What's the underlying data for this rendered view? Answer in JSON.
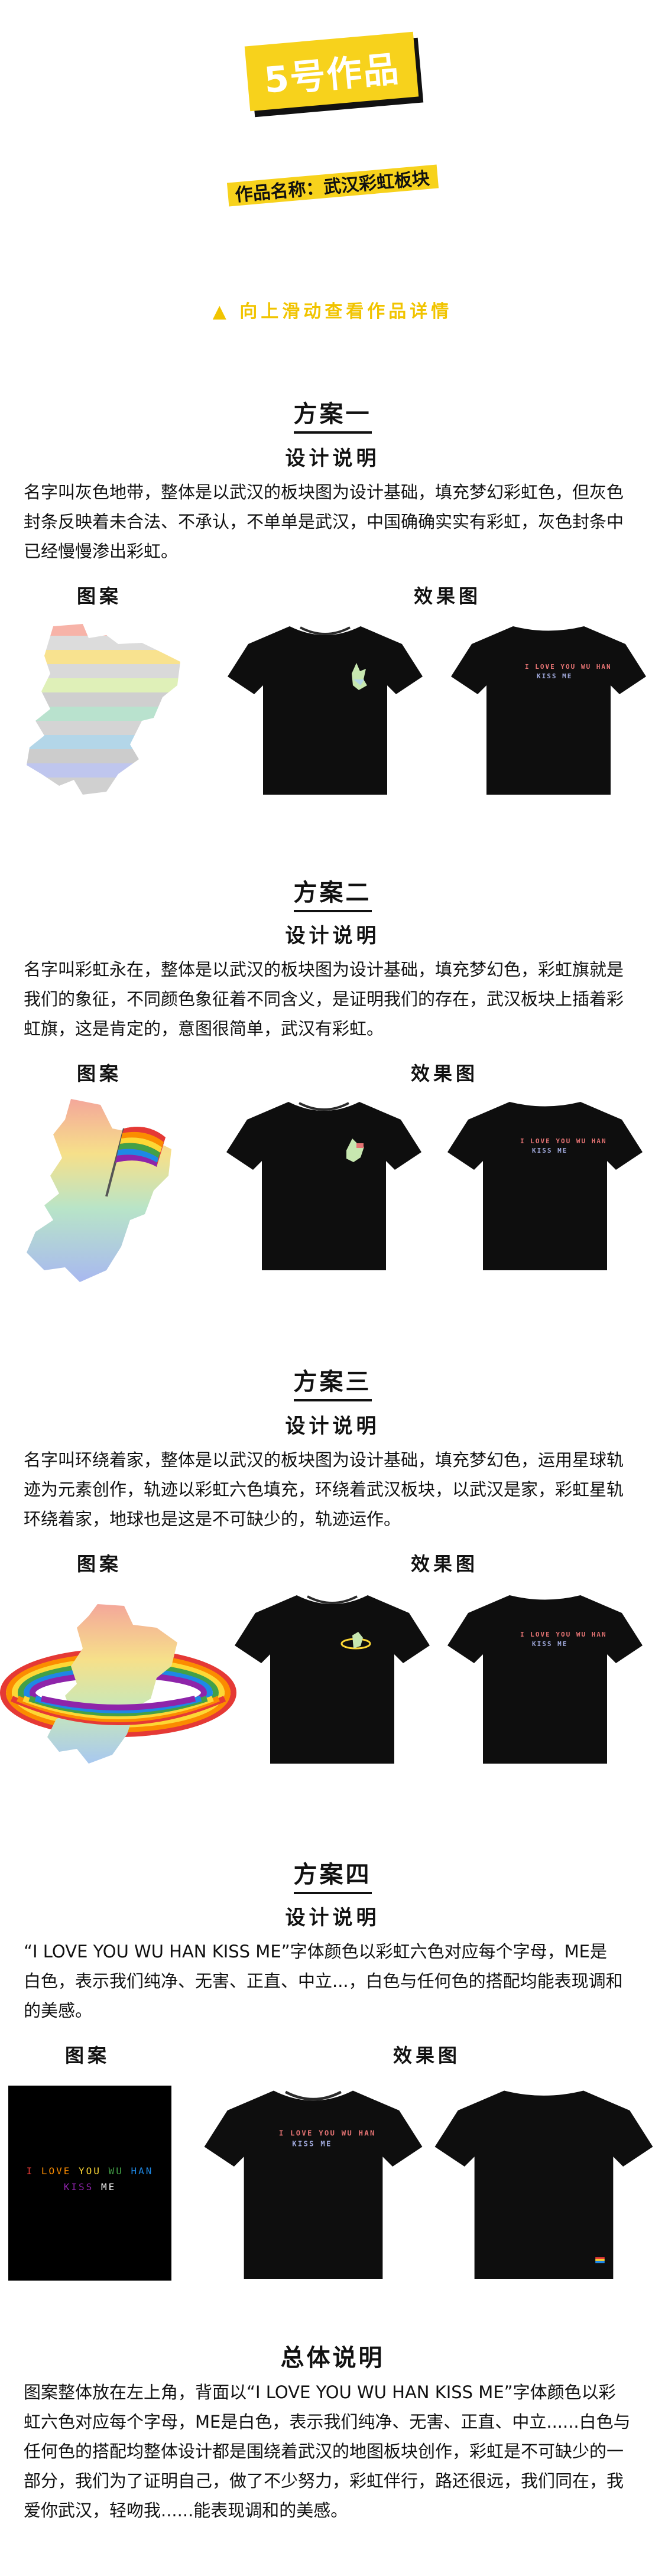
{
  "header": {
    "badge": "5号作品",
    "work_name": "作品名称：武汉彩虹板块",
    "scroll_hint": "▲  向上滑动查看作品详情"
  },
  "labels": {
    "design_desc": "设计说明",
    "pattern": "图案",
    "effect": "效果图"
  },
  "plans": [
    {
      "title": "方案一",
      "lines": [
        "名字叫灰色地带，整体是以武汉的板块图为设计基础，填充梦幻彩虹色，但灰色",
        "封条反映着未合法、不承认，不单单是武汉，中国确确实实有彩虹，灰色封条中",
        "已经慢慢渗出彩虹。"
      ]
    },
    {
      "title": "方案二",
      "lines": [
        "名字叫彩虹永在，整体是以武汉的板块图为设计基础，填充梦幻色，彩虹旗就是",
        "我们的象征，不同颜色象征着不同含义，是证明我们的存在，武汉板块上插着彩",
        "虹旗，这是肯定的，意图很简单，武汉有彩虹。"
      ]
    },
    {
      "title": "方案三",
      "lines": [
        "名字叫环绕着家，整体是以武汉的板块图为设计基础，填充梦幻色，运用星球轨",
        "迹为元素创作，轨迹以彩虹六色填充，环绕着武汉板块，以武汉是家，彩虹星轨",
        "环绕着家，地球也是这是不可缺少的，轨迹运作。"
      ]
    },
    {
      "title": "方案四",
      "lines": [
        "“I LOVE YOU WU HAN KISS ME”字体颜色以彩虹六色对应每个字母，ME是",
        "白色，表示我们纯净、无害、正直、中立...，白色与任何色的搭配均能表现调和",
        "的美感。"
      ]
    }
  ],
  "shirt_text": {
    "line1": "I LOVE YOU WU HAN",
    "line2": "KISS ME"
  },
  "summary": {
    "title": "总体说明",
    "lines": [
      "图案整体放在左上角，背面以“I LOVE YOU WU HAN KISS ME”字体颜色以彩",
      "虹六色对应每个字母，ME是白色，表示我们纯净、无害、正直、中立......白色与",
      "任何色的搭配均整体设计都是围绕着武汉的地图板块创作，彩虹是不可缺少的一",
      "部分，我们为了证明自己，做了不少努力，彩虹伴行，路还很远，我们同在，我",
      "爱你武汉，轻吻我......能表现调和的美感。"
    ]
  },
  "colors": {
    "accent_yellow": "#f7d21c",
    "rainbow": [
      "#e53935",
      "#fb8c00",
      "#fdd835",
      "#43a047",
      "#1e88e5",
      "#8e24aa"
    ]
  }
}
